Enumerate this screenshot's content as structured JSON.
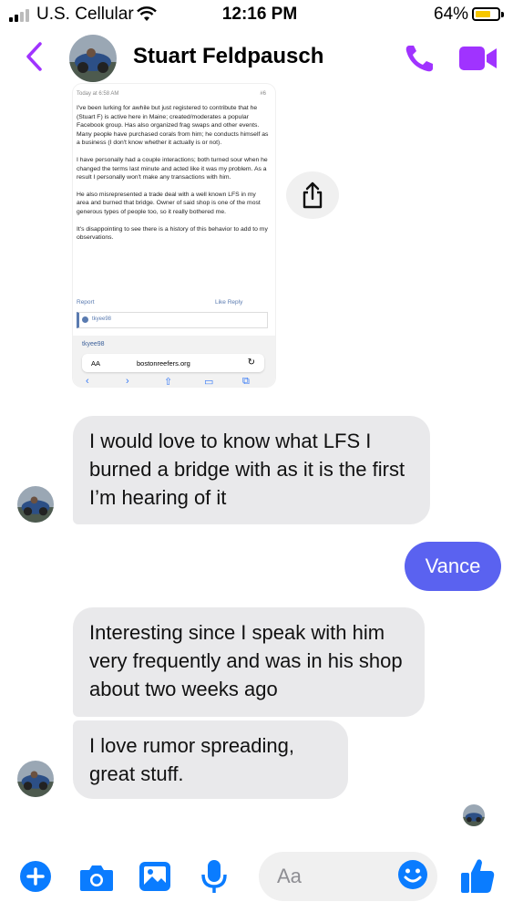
{
  "status_bar": {
    "carrier": "U.S. Cellular",
    "time": "12:16 PM",
    "battery": "64%",
    "battery_level": 0.64
  },
  "header": {
    "contact_name": "Stuart Feldpausch",
    "icons": [
      "chevron-left-icon",
      "phone-icon",
      "video-icon"
    ],
    "accent_color": "#a033ff"
  },
  "attachment": {
    "meta_left": "Today at 6:58 AM",
    "meta_right": "#6",
    "paragraphs": [
      "I've been lurking for awhile but just registered to contribute that he (Stuart F) is active here in Maine; created/moderates a popular Facebook group. Has also organized frag swaps and other events. Many people have purchased corals from him; he conducts himself as a business (I don't know whether it actually is or not).",
      "I have personally had a couple interactions; both turned sour when he changed the terms last minute and acted like it was my problem. As a result I personally won't make any transactions with him.",
      "He also misrepresented a trade deal with a well known LFS in my area and burned that bridge. Owner of said shop is one of the most generous types of people too, so it really bothered me.",
      "It's disappointing to see there is a history of this behavior to add to my observations."
    ],
    "report": "Report",
    "like_reply": "Like  Reply",
    "quote_user": "tkyee98",
    "user_name": "tkyee98",
    "url_aa": "AA",
    "url": "bostonreefers.org"
  },
  "messages": [
    {
      "from": "contact",
      "text": "I would love to know what LFS I burned a bridge with as it is the first I’m hearing of it"
    },
    {
      "from": "me",
      "text": "Vance"
    },
    {
      "from": "contact",
      "text": "Interesting since I speak with him very frequently and was in his shop about two weeks ago"
    },
    {
      "from": "contact",
      "text": "I love rumor spreading, great stuff."
    }
  ],
  "composer": {
    "placeholder": "Aa",
    "icons": [
      "plus-icon",
      "camera-icon",
      "image-icon",
      "microphone-icon",
      "emoji-icon",
      "thumbs-up-icon"
    ],
    "accent_color": "#0a7cff"
  },
  "colors": {
    "sent_bubble": "#5a62f0",
    "received_bubble": "#e9e9eb"
  }
}
